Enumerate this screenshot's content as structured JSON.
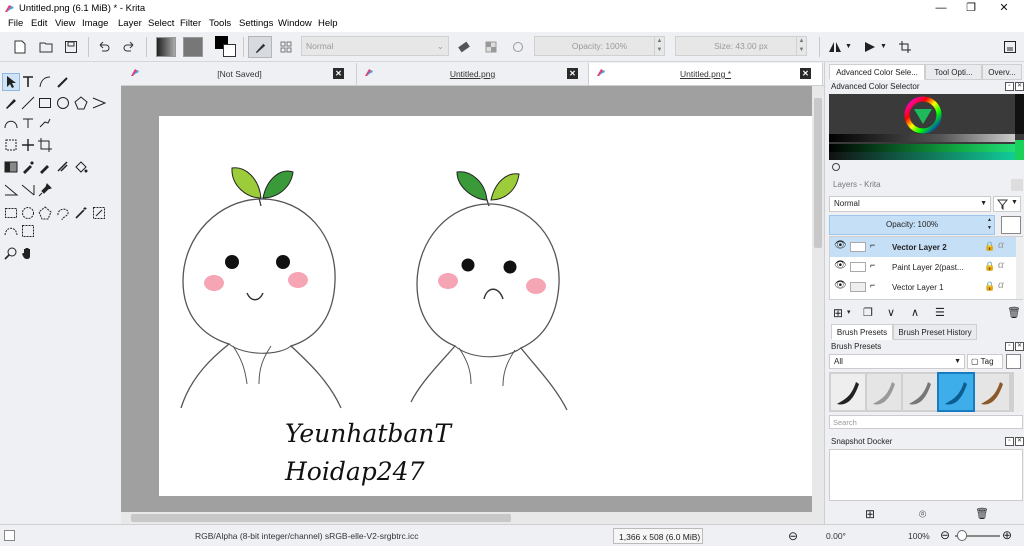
{
  "window": {
    "title": "Untitled.png (6.1 MiB)  * - Krita",
    "controls": {
      "minimize": "—",
      "maximize": "❐",
      "close": "✕"
    }
  },
  "menu": [
    "File",
    "Edit",
    "View",
    "Image",
    "Layer",
    "Select",
    "Filter",
    "Tools",
    "Settings",
    "Window",
    "Help"
  ],
  "toolbar": {
    "blend_mode": "Normal",
    "opacity": "Opacity: 100%",
    "size": "Size: 43.00 px"
  },
  "doc_tabs": [
    {
      "label": "[Not Saved]",
      "active": false
    },
    {
      "label": "Untitled.png",
      "active": false
    },
    {
      "label": "Untitled.png *",
      "active": true
    }
  ],
  "canvas": {
    "text_line1": "YeunhatbanT",
    "text_line2": "Hoidap247"
  },
  "right_dock": {
    "top_tabs": [
      "Advanced Color Sele...",
      "Tool Opti...",
      "Overv..."
    ],
    "color_selector_title": "Advanced Color Selector",
    "layers_title": "Layers - Krita",
    "layer_blend": "Normal",
    "layer_opacity": "Opacity:  100%",
    "layers": [
      {
        "name": "Vector Layer 2",
        "selected": true
      },
      {
        "name": "Paint Layer 2(past...",
        "selected": false
      },
      {
        "name": "Vector Layer 1",
        "selected": false
      }
    ],
    "brush_tabs": [
      "Brush Presets",
      "Brush Preset History"
    ],
    "brush_presets_title": "Brush Presets",
    "brush_filter": "All",
    "brush_tag": "Tag",
    "search_placeholder": "Search",
    "snapshot_title": "Snapshot Docker"
  },
  "status": {
    "color_info": "RGB/Alpha (8-bit integer/channel)  sRGB-elle-V2-srgbtrc.icc",
    "dimensions": "1,366 x 508 (6.0 MiB)",
    "rotation": "0.00°",
    "zoom": "100%"
  },
  "colors": {
    "accent": "#3daee9",
    "canvas_bg": "#a0a0a0",
    "leaf_light": "#9ccc3a",
    "leaf_dark": "#3a9a3a",
    "cheek": "#f6a5b5"
  }
}
